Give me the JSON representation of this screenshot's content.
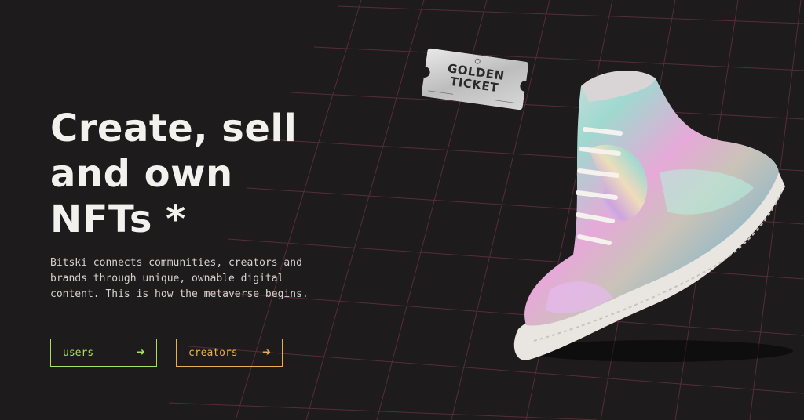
{
  "hero": {
    "title_lines": [
      "Create, sell",
      "and own",
      "NFTs *"
    ],
    "description": "Bitski connects communities, creators and brands through unique, ownable digital content. This is how the metaverse begins."
  },
  "buttons": {
    "users_label": "users",
    "creators_label": "creators",
    "arrow_icon": "arrow-right-icon"
  },
  "ticket": {
    "line1": "GOLDEN",
    "line2": "TICKET"
  },
  "colors": {
    "background": "#1d1b1c",
    "grid": "#6a3340",
    "users_accent": "#a8e05f",
    "creators_accent": "#e8b04a",
    "title": "#f3f1ee"
  }
}
